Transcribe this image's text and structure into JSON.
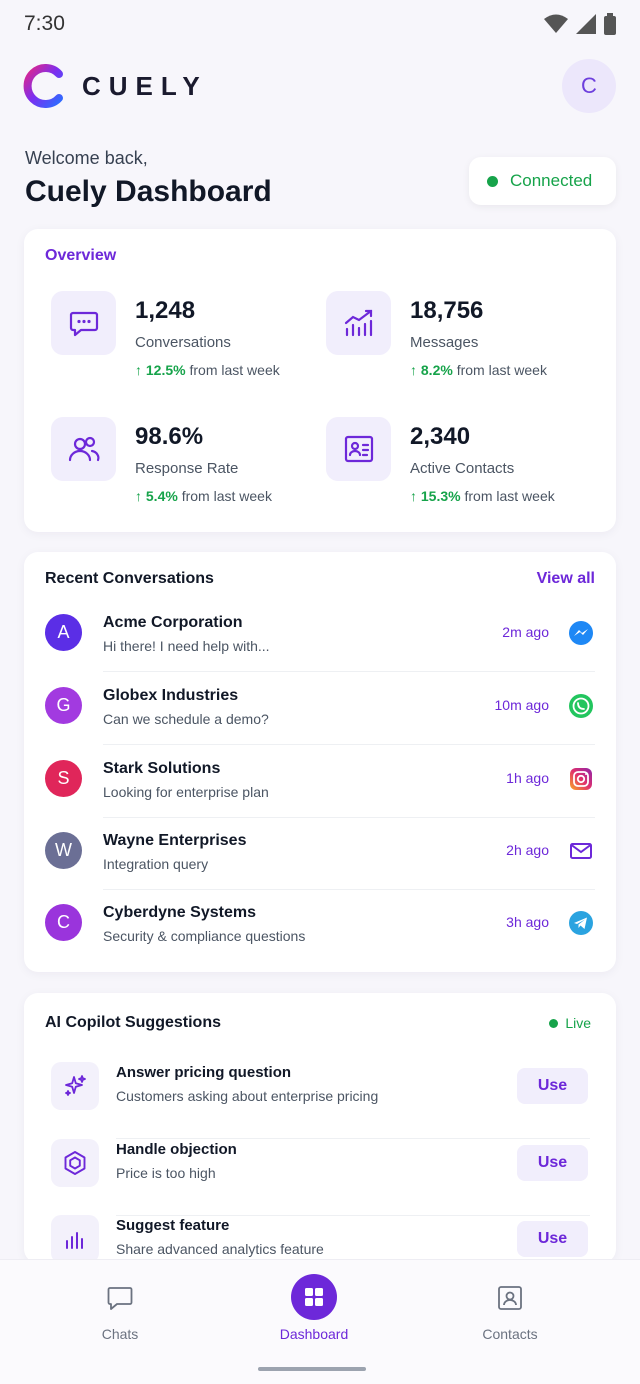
{
  "status_bar": {
    "time": "7:30"
  },
  "brand": {
    "name": "CUELY"
  },
  "user": {
    "avatar_initial": "C"
  },
  "welcome": {
    "subtitle": "Welcome back,",
    "title": "Cuely Dashboard"
  },
  "connection": {
    "label": "Connected",
    "color": "#16a34a"
  },
  "overview": {
    "title": "Overview",
    "stats": [
      {
        "value": "1,248",
        "label": "Conversations",
        "change": "12.5%",
        "change_suffix": "from last week",
        "icon": "chat-bubble-icon"
      },
      {
        "value": "18,756",
        "label": "Messages",
        "change": "8.2%",
        "change_suffix": "from last week",
        "icon": "bar-chart-trend-icon"
      },
      {
        "value": "98.6%",
        "label": "Response Rate",
        "change": "5.4%",
        "change_suffix": "from last week",
        "icon": "users-icon"
      },
      {
        "value": "2,340",
        "label": "Active Contacts",
        "change": "15.3%",
        "change_suffix": "from last week",
        "icon": "contact-card-icon"
      }
    ]
  },
  "recent": {
    "title": "Recent Conversations",
    "view_all": "View all",
    "items": [
      {
        "initial": "A",
        "name": "Acme Corporation",
        "message": "Hi there! I need help with...",
        "time": "2m ago",
        "channel": "messenger-icon",
        "avatar_color": "#5b2ee6"
      },
      {
        "initial": "G",
        "name": "Globex Industries",
        "message": "Can we schedule a demo?",
        "time": "10m ago",
        "channel": "whatsapp-icon",
        "avatar_color": "#a23ae0"
      },
      {
        "initial": "S",
        "name": "Stark Solutions",
        "message": "Looking for enterprise plan",
        "time": "1h ago",
        "channel": "instagram-icon",
        "avatar_color": "#e0265a"
      },
      {
        "initial": "W",
        "name": "Wayne Enterprises",
        "message": "Integration query",
        "time": "2h ago",
        "channel": "email-icon",
        "avatar_color": "#6b6f95"
      },
      {
        "initial": "C",
        "name": "Cyberdyne Systems",
        "message": "Security & compliance questions",
        "time": "3h ago",
        "channel": "telegram-icon",
        "avatar_color": "#9a34dc"
      }
    ]
  },
  "copilot": {
    "title": "AI Copilot Suggestions",
    "live_label": "Live",
    "items": [
      {
        "title": "Answer pricing question",
        "subtitle": "Customers asking about enterprise pricing",
        "button": "Use",
        "icon": "sparkles-icon"
      },
      {
        "title": "Handle objection",
        "subtitle": "Price is too high",
        "button": "Use",
        "icon": "hexagon-icon"
      },
      {
        "title": "Suggest feature",
        "subtitle": "Share advanced analytics feature",
        "button": "Use",
        "icon": "bar-chart-icon"
      }
    ]
  },
  "nav": {
    "items": [
      {
        "label": "Chats",
        "icon": "chat-icon"
      },
      {
        "label": "Dashboard",
        "icon": "grid-icon"
      },
      {
        "label": "Contacts",
        "icon": "contact-icon"
      }
    ],
    "active": "Dashboard"
  },
  "colors": {
    "accent": "#6d28d9",
    "positive": "#16a34a"
  }
}
